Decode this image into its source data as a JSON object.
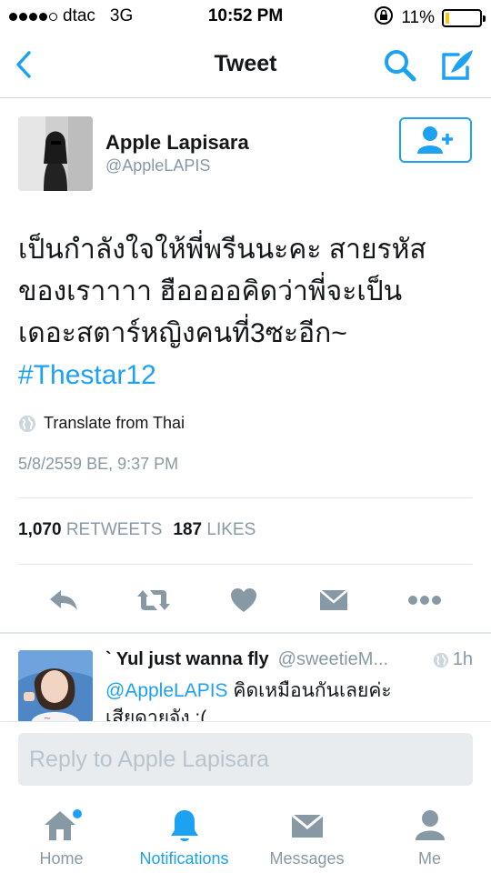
{
  "status_bar": {
    "carrier": "dtac",
    "network": "3G",
    "time": "10:52 PM",
    "battery": "11%",
    "battery_level": 0.11,
    "signal_bars": 4,
    "signal_total": 5
  },
  "nav": {
    "title": "Tweet"
  },
  "tweet": {
    "name": "Apple Lapisara",
    "handle": "@AppleLAPIS",
    "text_lines": [
      "เป็นกำลังใจให้พี่พรีนนะคะ สายรหัส",
      "ของเราาาา ฮืออออคิดว่าพี่จะเป็น",
      "เดอะสตาร์หญิงคนที่3ซะอีก~"
    ],
    "hashtag": "#Thestar12",
    "translate": "Translate from Thai",
    "timestamp": "5/8/2559 BE, 9:37 PM",
    "retweets_count": "1,070",
    "retweets_label": "RETWEETS",
    "likes_count": "187",
    "likes_label": "LIKES"
  },
  "reply": {
    "name": "` Yul just wanna fly",
    "handle": "@sweetieM...",
    "time": "1h",
    "mention": "@AppleLAPIS",
    "text_1": " คิดเหมือนกันเลยค่ะ",
    "text_2": "เสียดายจัง :("
  },
  "composer": {
    "placeholder": "Reply to Apple Lapisara"
  },
  "tabs": [
    {
      "label": "Home",
      "icon": "home-icon"
    },
    {
      "label": "Notifications",
      "icon": "bell-icon"
    },
    {
      "label": "Messages",
      "icon": "envelope-icon"
    },
    {
      "label": "Me",
      "icon": "person-icon"
    }
  ],
  "colors": {
    "accent": "#1da1f2",
    "secondary_text": "#8899a6",
    "icon_gray": "#8899a6"
  }
}
